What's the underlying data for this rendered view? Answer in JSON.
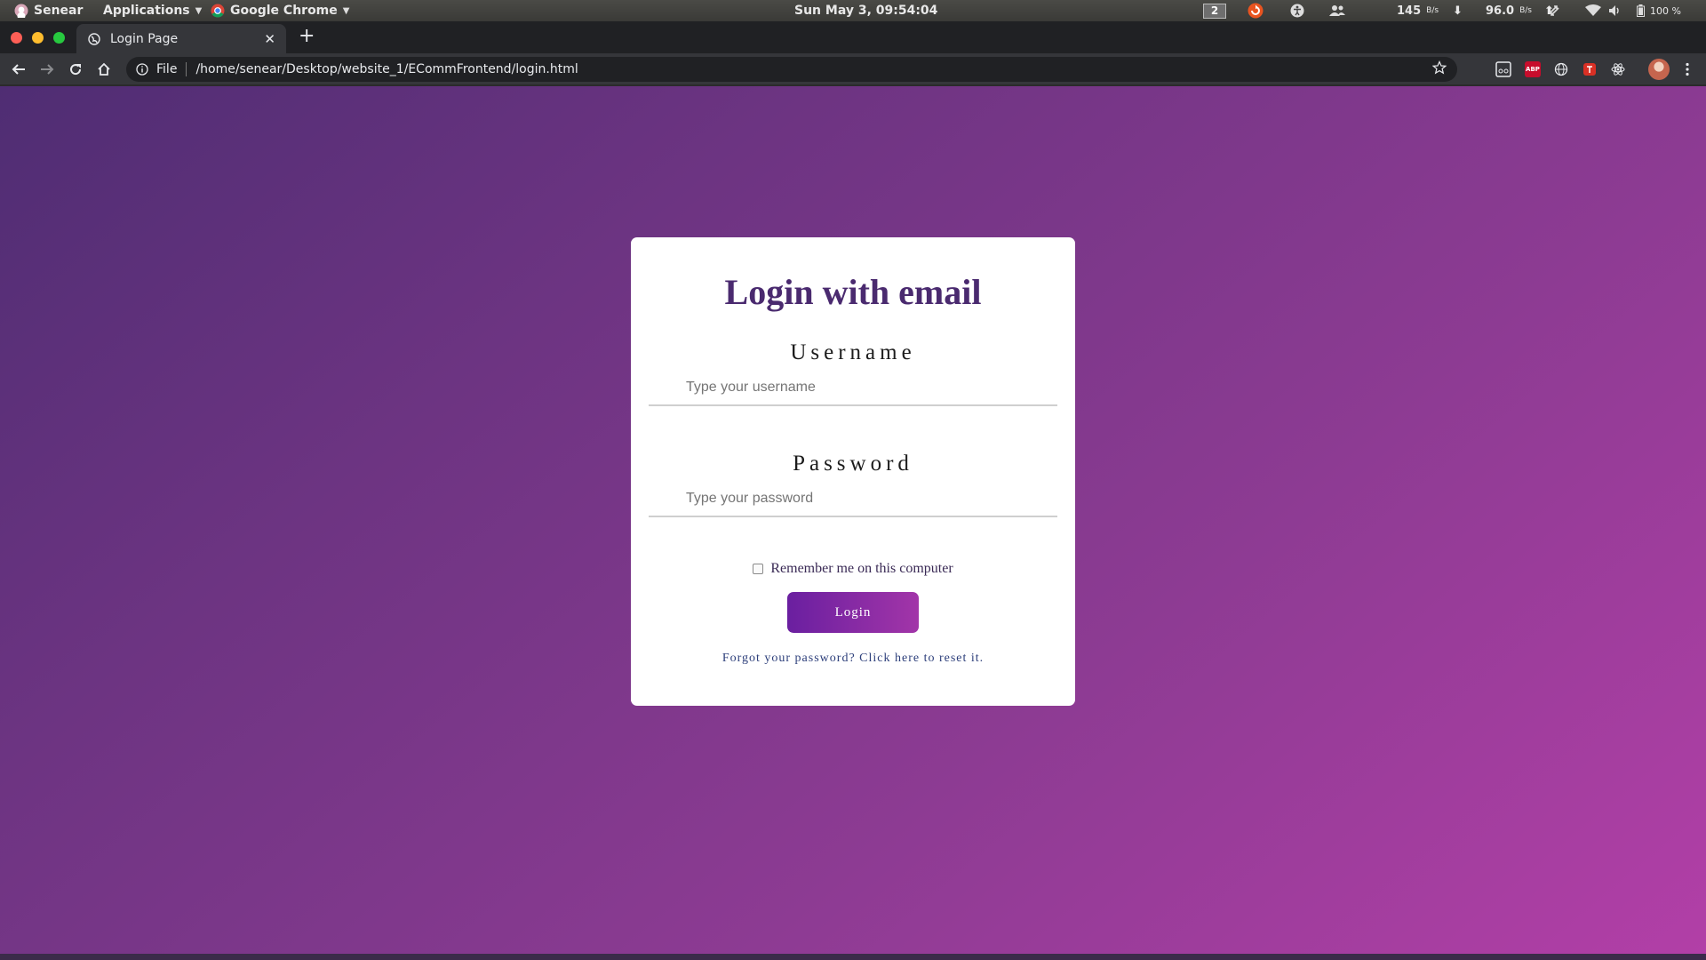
{
  "system_panel": {
    "user_label": "Senear",
    "applications_label": "Applications",
    "active_app_label": "Google Chrome",
    "clock": "Sun May  3, 09:54:04",
    "workspace_number": "2",
    "download_speed": "145",
    "download_unit": "B/s",
    "upload_speed": "96.0",
    "upload_unit": "B/s",
    "battery_label": "100 %"
  },
  "browser": {
    "tab_title": "Login Page",
    "omnibox_scheme": "File",
    "url": "/home/senear/Desktop/website_1/ECommFrontend/login.html",
    "extension_abp_label": "ABP"
  },
  "colors": {
    "page_gradient_start": "#4f2d73",
    "page_gradient_end": "#b23fa7",
    "heading": "#4a2a6f",
    "button_start": "#6a1fa0",
    "button_end": "#a235a8",
    "link": "#2c3e7a"
  },
  "login_form": {
    "title": "Login with email",
    "username_label": "Username",
    "username_placeholder": "Type your username",
    "password_label": "Password",
    "password_placeholder": "Type your password",
    "remember_label": "Remember me on this computer",
    "remember_checked": false,
    "login_button": "Login",
    "forgot_link": "Forgot your password? Click here to reset it."
  }
}
